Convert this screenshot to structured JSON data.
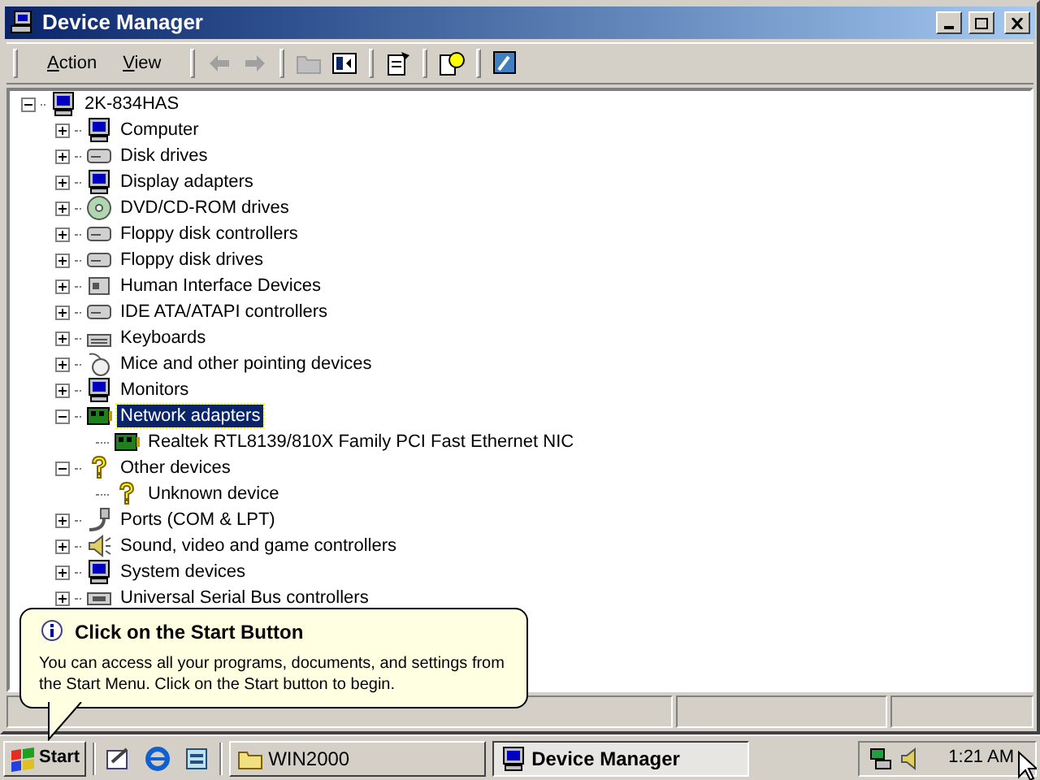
{
  "window": {
    "title": "Device Manager"
  },
  "menu": [
    {
      "label": "Action"
    },
    {
      "label": "View"
    }
  ],
  "tool_buttons": [
    {
      "disabled": true
    },
    {
      "disabled": true
    },
    {
      "disabled": true
    },
    {
      "disabled": false
    },
    {
      "disabled": false
    },
    {
      "disabled": false
    },
    {
      "disabled": false
    }
  ],
  "tree": {
    "label": "2K-834HAS",
    "expanded": true,
    "selected": false,
    "children": [
      {
        "label": "Computer",
        "expanded": false,
        "selected": false
      },
      {
        "label": "Disk drives",
        "expanded": false,
        "selected": false
      },
      {
        "label": "Display adapters",
        "expanded": false,
        "selected": false
      },
      {
        "label": "DVD/CD-ROM drives",
        "expanded": false,
        "selected": false
      },
      {
        "label": "Floppy disk controllers",
        "expanded": false,
        "selected": false
      },
      {
        "label": "Floppy disk drives",
        "expanded": false,
        "selected": false
      },
      {
        "label": "Human Interface Devices",
        "expanded": false,
        "selected": false
      },
      {
        "label": "IDE ATA/ATAPI controllers",
        "expanded": false,
        "selected": false
      },
      {
        "label": "Keyboards",
        "expanded": false,
        "selected": false
      },
      {
        "label": "Mice and other pointing devices",
        "expanded": false,
        "selected": false
      },
      {
        "label": "Monitors",
        "expanded": false,
        "selected": false
      },
      {
        "label": "Network adapters",
        "expanded": true,
        "selected": true,
        "children": [
          {
            "label": "Realtek RTL8139/810X Family PCI Fast Ethernet NIC",
            "selected": false
          }
        ]
      },
      {
        "label": "Other devices",
        "expanded": true,
        "selected": false,
        "children": [
          {
            "label": "Unknown device",
            "selected": false
          }
        ]
      },
      {
        "label": "Ports (COM & LPT)",
        "expanded": false,
        "selected": false
      },
      {
        "label": "Sound, video and game controllers",
        "expanded": false,
        "selected": false
      },
      {
        "label": "System devices",
        "expanded": false,
        "selected": false
      },
      {
        "label": "Universal Serial Bus controllers",
        "expanded": false,
        "selected": false
      }
    ]
  },
  "balloon": {
    "title": "Click on the Start Button",
    "text": "You can access all your programs, documents, and settings from the Start Menu. Click on the Start button to begin."
  },
  "taskbar": {
    "start": "Start",
    "tasks": [
      {
        "label": "WIN2000",
        "selected": false
      },
      {
        "label": "Device Manager",
        "selected": true
      }
    ],
    "clock": "1:21 AM"
  }
}
